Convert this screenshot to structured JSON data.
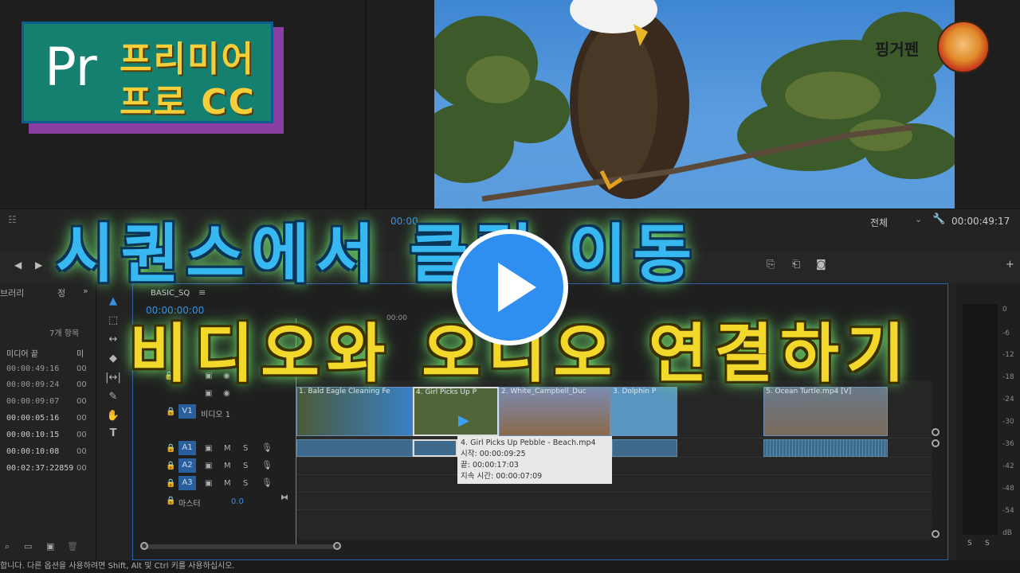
{
  "overlay": {
    "logo_pr": "Pr",
    "logo_line1": "프리미어",
    "logo_line2": "프로 CC",
    "headline_line1": "시퀀스에서 클립 이동",
    "headline_line2": "비디오와 오디오 연결하기",
    "channel_name": "핑거펜",
    "play_icon": "play-triangle-icon"
  },
  "monitor": {
    "timecode_left": "00:00",
    "fit_select": "전체",
    "timecode_right": "00:00:49:17"
  },
  "project_panel": {
    "title": "브러리",
    "tab2": "정",
    "item_count": "7개 항목",
    "column_header": "미디어 끝",
    "column_header2": "미",
    "rows": [
      "00:00:49:16",
      "00:00:09:24",
      "00:00:09:07",
      "00:00:05:16",
      "00:00:10:15",
      "00:00:10:08",
      "00:02:37:22859"
    ],
    "rows_col2": [
      "00",
      "00",
      "00",
      "00",
      "00",
      "00",
      "00"
    ]
  },
  "timeline": {
    "sequence_name": "BASIC_SQ",
    "playhead_time": "00:00:00:00",
    "ruler_mark": "00:00",
    "tracks": {
      "v1_badge": "V1",
      "v1_label": "비디오 1",
      "a1": "A1",
      "a2": "A2",
      "a3": "A3",
      "master_label": "마스터",
      "master_value": "0.0",
      "m": "M",
      "s": "S"
    },
    "clips": [
      "1. Bald Eagle Cleaning Fe",
      "4. Girl Picks Up P",
      "2. White_Campbell_Duc",
      "3. Dolphin P",
      "5. Ocean Turtle.mp4 [V]"
    ]
  },
  "tooltip": {
    "title": "4. Girl Picks Up Pebble - Beach.mp4",
    "start": "시작: 00:00:09:25",
    "end": "끝: 00:00:17:03",
    "duration": "지속 시간: 00:00:07:09"
  },
  "meter": {
    "db_labels": [
      "0",
      "-6",
      "-12",
      "-18",
      "-24",
      "-30",
      "-36",
      "-42",
      "-48",
      "-54",
      "dB"
    ],
    "solo1": "S",
    "solo2": "S"
  },
  "status_bar": {
    "text": "합니다. 다른 옵션을 사용하려면 Shift, Alt 및 Ctrl 키를 사용하십시오."
  }
}
